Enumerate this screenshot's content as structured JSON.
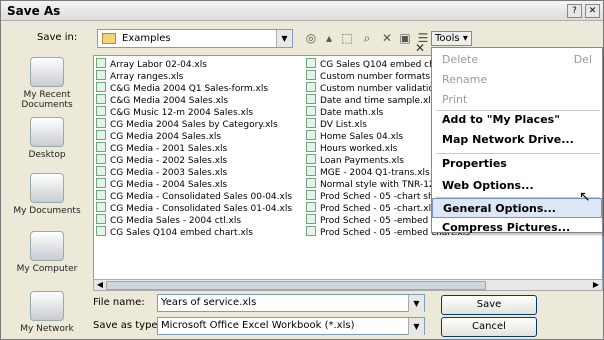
{
  "window": {
    "title": "Save As",
    "help_btn": "?",
    "close_btn": "✕"
  },
  "savein": {
    "label": "Save in:",
    "value": "Examples"
  },
  "toolbar": {
    "tools_label": "Tools ▾"
  },
  "places": [
    {
      "label": "My Recent Documents",
      "icon": "recent-documents-icon"
    },
    {
      "label": "Desktop",
      "icon": "desktop-icon"
    },
    {
      "label": "My Documents",
      "icon": "my-documents-icon"
    },
    {
      "label": "My Computer",
      "icon": "my-computer-icon"
    },
    {
      "label": "My Network",
      "icon": "my-network-icon"
    }
  ],
  "files_left": [
    "Array Labor 02-04.xls",
    "Array ranges.xls",
    "C&G Media 2004 Q1 Sales-form.xls",
    "C&G Media 2004 Sales.xls",
    "C&G Music 12-m 2004 Sales.xls",
    "CG Media 2004 Sales by Category.xls",
    "CG Media 2004 Sales.xls",
    "CG Media - 2001 Sales.xls",
    "CG Media - 2002 Sales.xls",
    "CG Media - 2003 Sales.xls",
    "CG Media - 2004 Sales.xls",
    "CG Media - Consolidated Sales 00-04.xls",
    "CG Media - Consolidated Sales 01-04.xls",
    "CG Media Sales - 2004 ctl.xls",
    "CG Sales Q104 embed chart.xls"
  ],
  "files_right": [
    "CG Sales Q104 embed che",
    "Custom number formats &",
    "Custom number validation",
    "Date and time sample.xls",
    "Date math.xls",
    "DV List.xls",
    "Home Sales 04.xls",
    "Hours worked.xls",
    "Loan Payments.xls",
    "MGE - 2004 Q1-trans.xls",
    "Normal style with TNR-12.",
    "Prod Sched - 05 -chart sh",
    "Prod Sched - 05 -chart.xls",
    "Prod Sched - 05 -embed chart - small text.xls",
    "Prod Sched - 05 -embed chart.xls"
  ],
  "filename": {
    "label": "File name:",
    "value": "Years of service.xls"
  },
  "savetype": {
    "label": "Save as type:",
    "value": "Microsoft Office Excel Workbook (*.xls)"
  },
  "buttons": {
    "save": "Save",
    "cancel": "Cancel"
  },
  "menu": {
    "items": [
      {
        "label": "Delete",
        "shortcut": "Del",
        "disabled": true
      },
      {
        "label": "Rename",
        "shortcut": "",
        "disabled": true
      },
      {
        "label": "Print",
        "shortcut": "",
        "disabled": true
      },
      {
        "label": "Add to \"My Places\"",
        "shortcut": "",
        "disabled": false
      },
      {
        "label": "Map Network Drive...",
        "shortcut": "",
        "disabled": false
      },
      {
        "label": "Properties",
        "shortcut": "",
        "disabled": false
      },
      {
        "label": "Web Options...",
        "shortcut": "",
        "disabled": false
      },
      {
        "label": "General Options...",
        "shortcut": "",
        "disabled": false,
        "highlighted": true
      },
      {
        "label": "Compress Pictures...",
        "shortcut": "",
        "disabled": false
      }
    ]
  }
}
